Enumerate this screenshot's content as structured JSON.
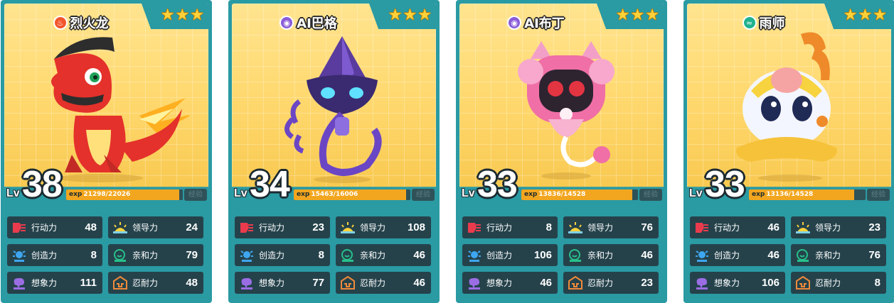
{
  "colors": {
    "card_border": "#2a9aa3",
    "card_top_bg": "#ffd970",
    "stat_bg": "#25424b",
    "exp_fill": "#f2a61f",
    "fire_element": "#f2552c",
    "dark_element": "#8a5bd8",
    "water_element": "#1fb28e"
  },
  "labels": {
    "lv": "Lv",
    "exp": "exp",
    "exp_button": "经验",
    "action": "行动力",
    "leadership": "领导力",
    "creativity": "创造力",
    "affinity": "亲和力",
    "imagination": "想象力",
    "endurance": "忍耐力"
  },
  "cards": [
    {
      "name": "烈火龙",
      "element_icon": "fire-element-icon",
      "stars": 3,
      "level": "38",
      "exp_current": "21298",
      "exp_max": "22026",
      "exp_fraction": 0.967,
      "stats": {
        "action": "48",
        "leadership": "24",
        "creativity": "8",
        "affinity": "79",
        "imagination": "111",
        "endurance": "48"
      }
    },
    {
      "name": "AI巴格",
      "element_icon": "dark-element-icon",
      "stars": 3,
      "level": "34",
      "exp_current": "15463",
      "exp_max": "16006",
      "exp_fraction": 0.966,
      "stats": {
        "action": "23",
        "leadership": "108",
        "creativity": "8",
        "affinity": "46",
        "imagination": "77",
        "endurance": "46"
      }
    },
    {
      "name": "AI布丁",
      "element_icon": "dark-element-icon",
      "stars": 3,
      "level": "33",
      "exp_current": "13836",
      "exp_max": "14528",
      "exp_fraction": 0.952,
      "stats": {
        "action": "8",
        "leadership": "76",
        "creativity": "106",
        "affinity": "46",
        "imagination": "46",
        "endurance": "23"
      }
    },
    {
      "name": "雨师",
      "element_icon": "water-element-icon",
      "stars": 3,
      "level": "33",
      "exp_current": "13136",
      "exp_max": "14528",
      "exp_fraction": 0.904,
      "stats": {
        "action": "46",
        "leadership": "23",
        "creativity": "46",
        "affinity": "76",
        "imagination": "106",
        "endurance": "8"
      }
    }
  ]
}
